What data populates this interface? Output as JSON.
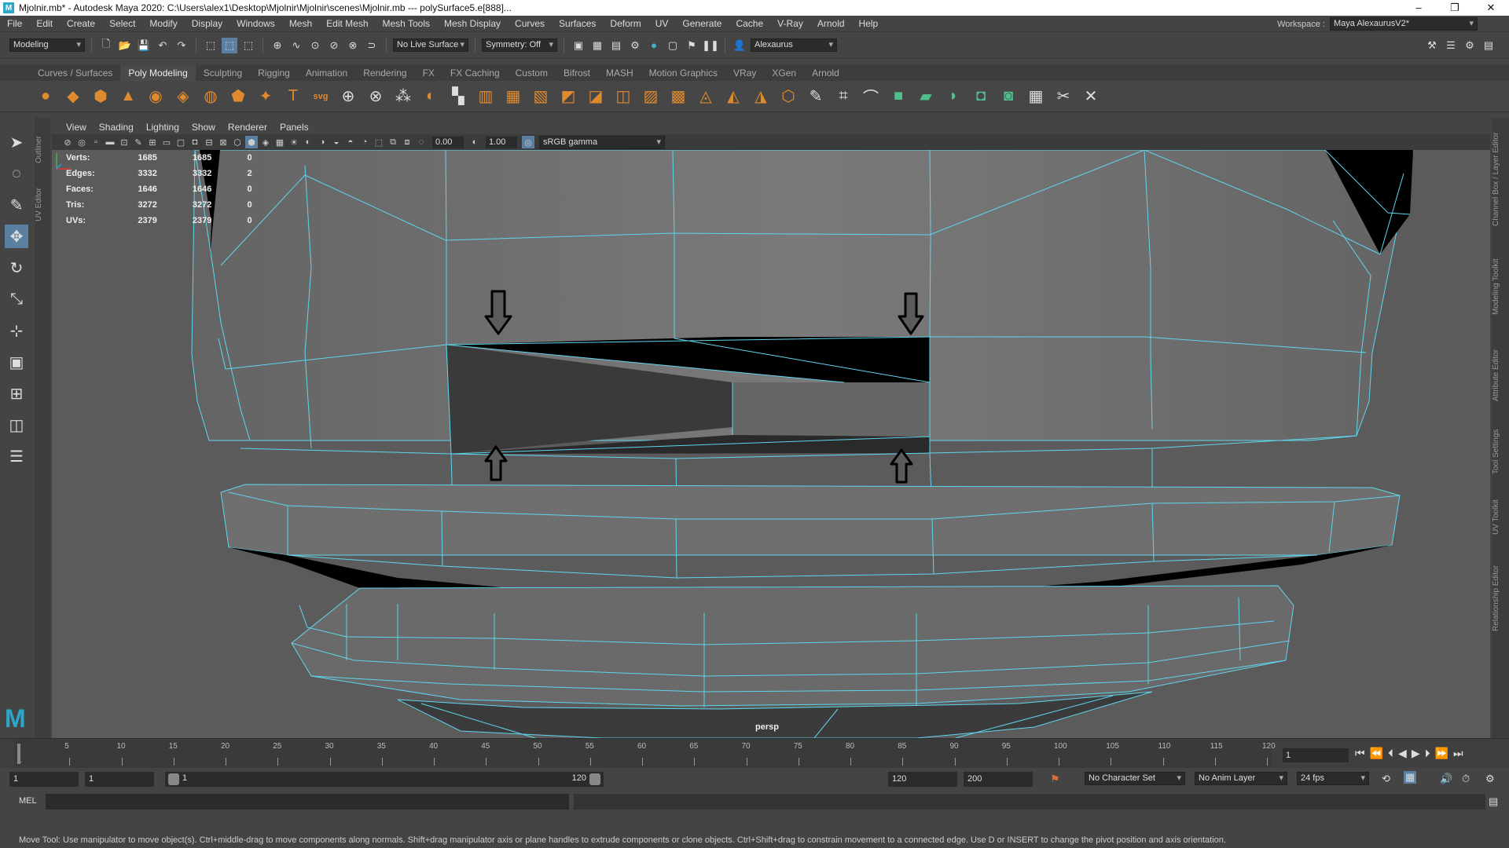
{
  "window": {
    "title": "Mjolnir.mb* - Autodesk Maya 2020: C:\\Users\\alex1\\Desktop\\Mjolnir\\Mjolnir\\scenes\\Mjolnir.mb   ---   polySurface5.e[888]..."
  },
  "menus": [
    "File",
    "Edit",
    "Create",
    "Select",
    "Modify",
    "Display",
    "Windows",
    "Mesh",
    "Edit Mesh",
    "Mesh Tools",
    "Mesh Display",
    "Curves",
    "Surfaces",
    "Deform",
    "UV",
    "Generate",
    "Cache",
    "V-Ray",
    "Arnold",
    "Help"
  ],
  "workspace": {
    "label": "Workspace :",
    "value": "Maya AlexaurusV2*"
  },
  "statusline": {
    "mode": "Modeling",
    "live_surface": "No Live Surface",
    "symmetry": "Symmetry: Off",
    "user": "Alexaurus"
  },
  "shelf_tabs": [
    "Curves / Surfaces",
    "Poly Modeling",
    "Sculpting",
    "Rigging",
    "Animation",
    "Rendering",
    "FX",
    "FX Caching",
    "Custom",
    "Bifrost",
    "MASH",
    "Motion Graphics",
    "VRay",
    "XGen",
    "Arnold"
  ],
  "shelf_active_tab": "Poly Modeling",
  "left_tabs": [
    "Outliner",
    "UV Editor"
  ],
  "right_tabs": [
    "Channel Box / Layer Editor",
    "Modeling Toolkit",
    "Attribute Editor",
    "Tool Settings",
    "UV Toolkit",
    "Relationship Editor"
  ],
  "panel_menus": [
    "View",
    "Shading",
    "Lighting",
    "Show",
    "Renderer",
    "Panels"
  ],
  "panel_toolbar": {
    "exposure": "0.00",
    "gamma": "1.00",
    "colorspace": "sRGB gamma"
  },
  "hud": [
    {
      "label": "Verts:",
      "v1": "1685",
      "v2": "1685",
      "v3": "0"
    },
    {
      "label": "Edges:",
      "v1": "3332",
      "v2": "3332",
      "v3": "2"
    },
    {
      "label": "Faces:",
      "v1": "1646",
      "v2": "1646",
      "v3": "0"
    },
    {
      "label": "Tris:",
      "v1": "3272",
      "v2": "3272",
      "v3": "0"
    },
    {
      "label": "UVs:",
      "v1": "2379",
      "v2": "2379",
      "v3": "0"
    }
  ],
  "camera": "persp",
  "timeline": {
    "ticks": [
      "5",
      "10",
      "15",
      "20",
      "25",
      "30",
      "35",
      "40",
      "45",
      "50",
      "55",
      "60",
      "65",
      "70",
      "75",
      "80",
      "85",
      "90",
      "95",
      "100",
      "105",
      "110",
      "115",
      "120"
    ],
    "start_tick": "1",
    "current_frame": "1"
  },
  "range": {
    "start": "1",
    "inner_start": "1",
    "slider_start": "1",
    "slider_end": "120",
    "end": "120",
    "max": "200",
    "character_set": "No Character Set",
    "anim_layer": "No Anim Layer",
    "fps": "24 fps"
  },
  "cmdline": {
    "lang": "MEL"
  },
  "help": "Move Tool: Use manipulator to move object(s). Ctrl+middle-drag to move components along normals. Shift+drag manipulator axis or plane handles to extrude components or clone objects. Ctrl+Shift+drag to constrain movement to a connected edge. Use D or INSERT to change the pivot position and axis orientation.",
  "colors": {
    "viewport_bg": "#5b5b5b",
    "mesh_face": "#6e6e6e",
    "wire": "#5fd6ee",
    "hole": "#000000",
    "accent": "#2aa7c9"
  }
}
